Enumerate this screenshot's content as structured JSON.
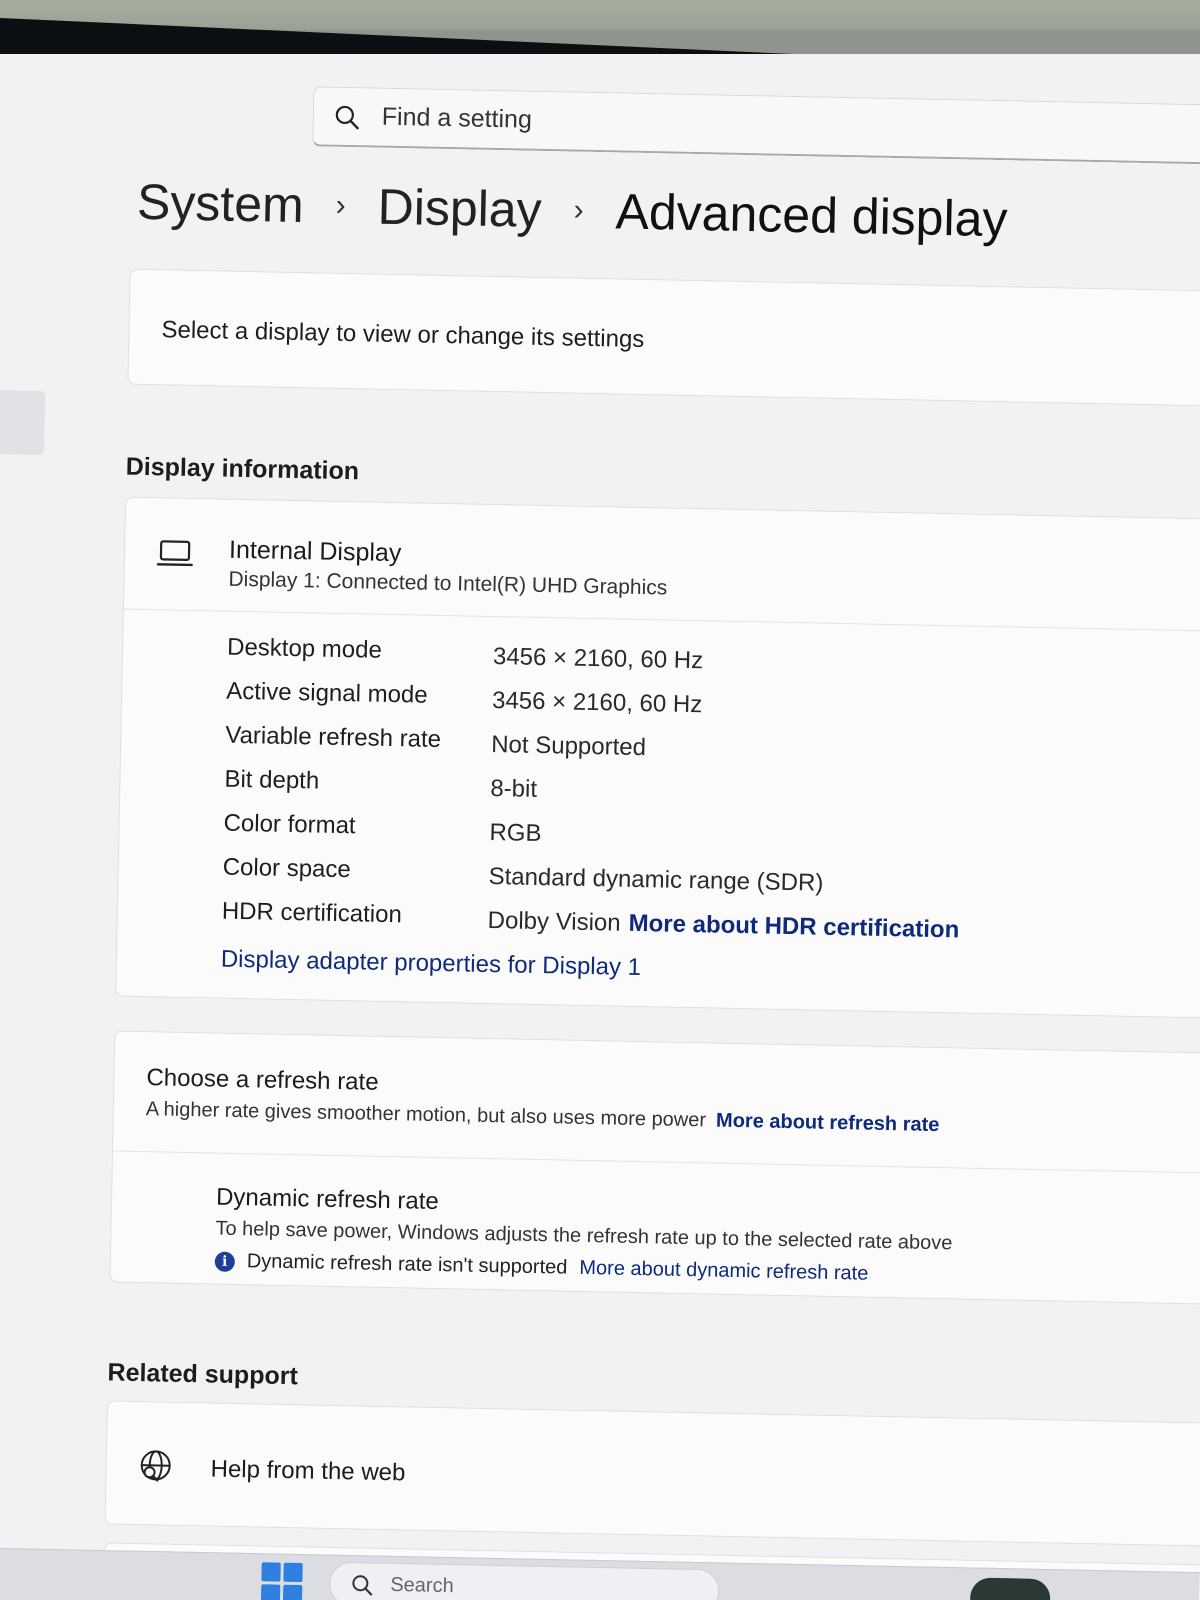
{
  "search": {
    "placeholder": "Find a setting"
  },
  "breadcrumb": [
    "System",
    "Display",
    "Advanced display"
  ],
  "select_display": {
    "label": "Select a display to view or change its settings"
  },
  "display_information": {
    "section_title": "Display information",
    "display_name": "Internal Display",
    "display_subtitle": "Display 1: Connected to Intel(R) UHD Graphics",
    "specs": [
      {
        "label": "Desktop mode",
        "value": "3456 × 2160, 60 Hz"
      },
      {
        "label": "Active signal mode",
        "value": "3456 × 2160, 60 Hz"
      },
      {
        "label": "Variable refresh rate",
        "value": "Not Supported"
      },
      {
        "label": "Bit depth",
        "value": "8-bit"
      },
      {
        "label": "Color format",
        "value": "RGB"
      },
      {
        "label": "Color space",
        "value": "Standard dynamic range (SDR)"
      },
      {
        "label": "HDR certification",
        "value": "Dolby Vision",
        "link": "More about HDR certification"
      }
    ],
    "adapter_link": "Display adapter properties for Display 1"
  },
  "refresh_rate": {
    "title": "Choose a refresh rate",
    "description": "A higher rate gives smoother motion, but also uses more power",
    "link": "More about refresh rate",
    "dynamic": {
      "title": "Dynamic refresh rate",
      "description": "To help save power, Windows adjusts the refresh rate up to the selected rate above",
      "note": "Dynamic refresh rate isn't supported",
      "note_link": "More about dynamic refresh rate"
    }
  },
  "related_support": {
    "section_title": "Related support",
    "help_label": "Help from the web"
  },
  "taskbar": {
    "search_text": "Search"
  },
  "icons": {
    "search": "search-icon",
    "laptop": "laptop-icon",
    "info": "info-icon",
    "globe": "globe-search-icon",
    "start": "windows-logo-icon"
  },
  "colors": {
    "accent_link": "#0f2a7a",
    "info_dot": "#1f3f97",
    "start_blue": "#2f7fe0"
  }
}
